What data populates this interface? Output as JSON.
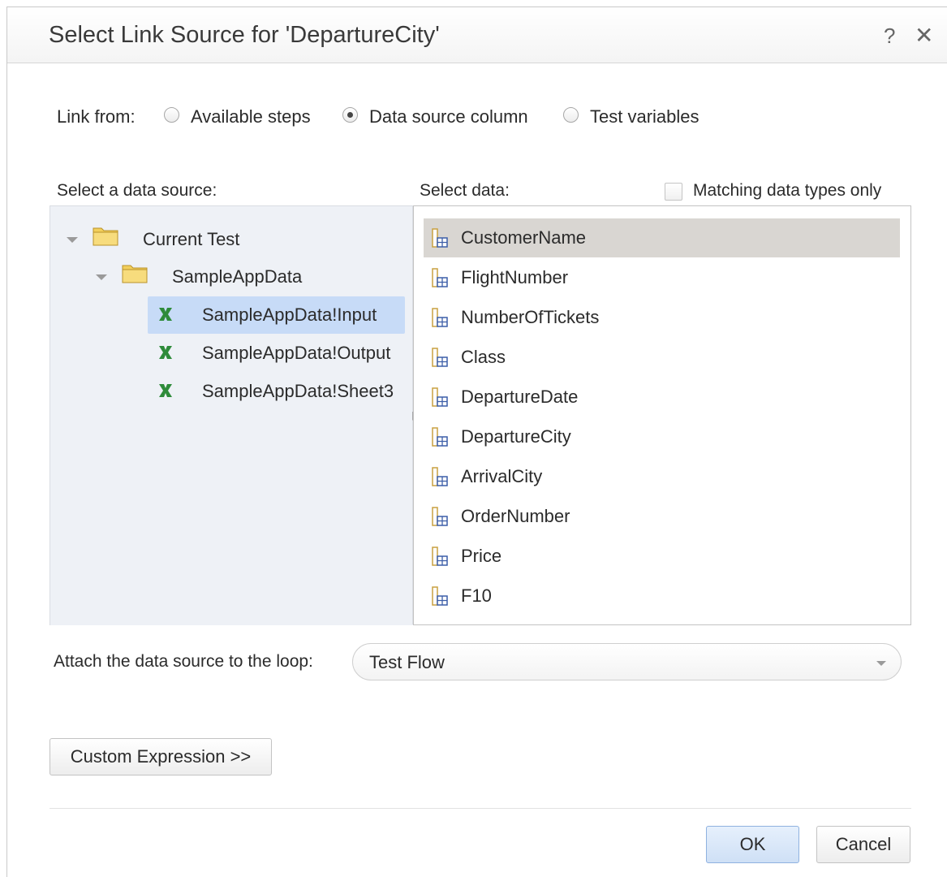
{
  "dialog": {
    "title": "Select Link Source for 'DepartureCity'",
    "help_label": "?",
    "close_label": "✕"
  },
  "link_from": {
    "label": "Link from:",
    "options": [
      {
        "label": "Available steps",
        "checked": false
      },
      {
        "label": "Data source column",
        "checked": true
      },
      {
        "label": "Test variables",
        "checked": false
      }
    ]
  },
  "data_source": {
    "label": "Select a data source:",
    "tree": [
      {
        "label": "Current Test",
        "icon": "folder-icon",
        "level": 0,
        "expanded": true
      },
      {
        "label": "SampleAppData",
        "icon": "folder-icon",
        "level": 1,
        "expanded": true
      },
      {
        "label": "SampleAppData!Input",
        "icon": "excel-icon",
        "level": 2,
        "selected": true
      },
      {
        "label": "SampleAppData!Output",
        "icon": "excel-icon",
        "level": 2,
        "selected": false
      },
      {
        "label": "SampleAppData!Sheet3",
        "icon": "excel-icon",
        "level": 2,
        "selected": false
      }
    ]
  },
  "select_data": {
    "label": "Select data:",
    "matching_label": "Matching data types only",
    "matching_checked": false,
    "columns": [
      {
        "label": "CustomerName",
        "selected": true
      },
      {
        "label": "FlightNumber",
        "selected": false
      },
      {
        "label": "NumberOfTickets",
        "selected": false
      },
      {
        "label": "Class",
        "selected": false
      },
      {
        "label": "DepartureDate",
        "selected": false
      },
      {
        "label": "DepartureCity",
        "selected": false
      },
      {
        "label": "ArrivalCity",
        "selected": false
      },
      {
        "label": "OrderNumber",
        "selected": false
      },
      {
        "label": "Price",
        "selected": false
      },
      {
        "label": "F10",
        "selected": false
      }
    ]
  },
  "loop": {
    "label": "Attach the data source to the loop:",
    "value": "Test Flow"
  },
  "buttons": {
    "custom_expression": "Custom Expression >>",
    "ok": "OK",
    "cancel": "Cancel"
  },
  "colors": {
    "selected_tree": "#c7dbf7",
    "selected_column": "#d9d6d2",
    "excel_green": "#2e8b3a",
    "folder_yellow": "#f2cf5b"
  }
}
